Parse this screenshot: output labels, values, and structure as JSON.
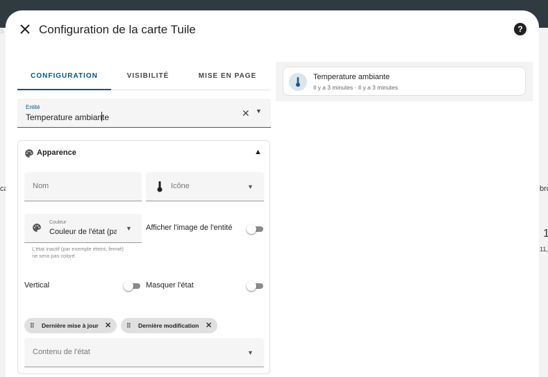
{
  "background": {
    "frag_left_1": "s",
    "frag_left_2": "ca",
    "frag_right_1": "bro",
    "frag_right_2": "1",
    "frag_right_3": "11,"
  },
  "dialog": {
    "title": "Configuration de la carte Tuile",
    "help_label": "?"
  },
  "tabs": [
    {
      "label": "CONFIGURATION",
      "active": true
    },
    {
      "label": "VISIBILITÉ",
      "active": false
    },
    {
      "label": "MISE EN PAGE",
      "active": false
    }
  ],
  "entity": {
    "label": "Entité",
    "value": "Temperature ambiante"
  },
  "appearance": {
    "title": "Apparence",
    "name_placeholder": "Nom",
    "icon_placeholder": "Icône",
    "color": {
      "label": "Couleur",
      "value": "Couleur de l'état (par"
    },
    "color_hint": "L'état inactif (par exemple éteint, fermé) ne sera pas coloré.",
    "show_entity_picture_label": "Afficher l'image de l'entité",
    "vertical_label": "Vertical",
    "hide_state_label": "Masquer l'état",
    "chips": [
      {
        "label": "Dernière mise à jour"
      },
      {
        "label": "Dernière modification"
      }
    ],
    "state_content_placeholder": "Contenu de l'état"
  },
  "preview": {
    "name": "Temperature ambiante",
    "secondary": "Il y a 3 minutes · Il y a 3 minutes"
  },
  "colors": {
    "accent": "#03577f",
    "header_bar": "#2f3b40"
  }
}
